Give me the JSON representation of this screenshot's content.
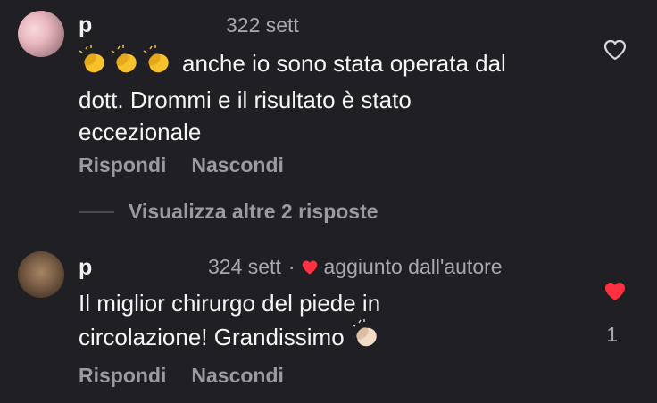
{
  "comments": [
    {
      "username": "p",
      "timestamp": "322 sett",
      "text_line1": "anche io sono stata operata dal",
      "text_line2": "dott. Drommi e il risultato è stato",
      "text_line3": "eccezionale",
      "emoji_prefix": [
        "clapping-hands",
        "clapping-hands",
        "clapping-hands"
      ],
      "liked": false,
      "reply_label": "Rispondi",
      "hide_label": "Nascondi"
    },
    {
      "username": "p",
      "timestamp": "324 sett",
      "separator": "·",
      "author_tag": "aggiunto dall'autore",
      "text_line1": "Il miglior chirurgo del piede in",
      "text_line2": "circolazione! Grandissimo",
      "emoji_suffix": "clapping-hands-light-skin",
      "liked": true,
      "like_count": "1",
      "reply_label": "Rispondi",
      "hide_label": "Nascondi"
    }
  ],
  "replies_toggle": {
    "label": "Visualizza altre 2 risposte"
  },
  "colors": {
    "background": "#1f1f24",
    "primary_text": "#f5f5f5",
    "secondary_text": "#a8a8ad",
    "like_red": "#ff3040",
    "emoji_yellow": "#f6c12b"
  }
}
